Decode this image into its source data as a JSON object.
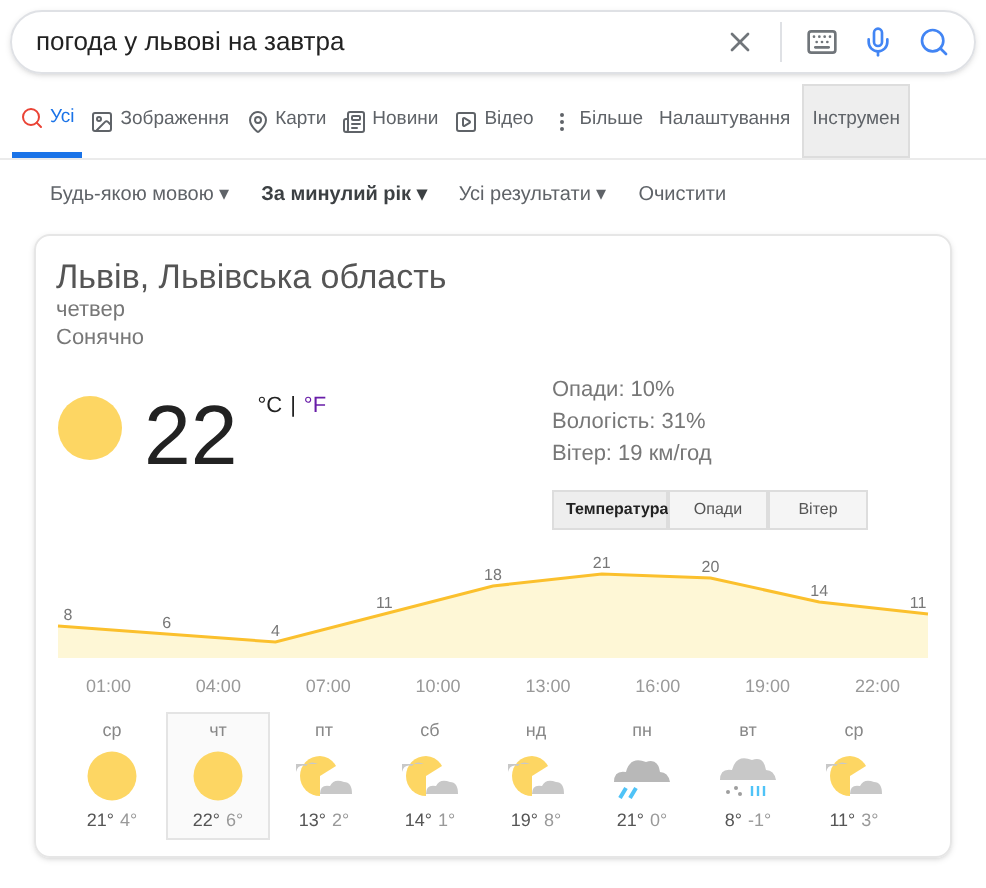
{
  "search": {
    "value": "погода у львові на завтра"
  },
  "tabs": [
    {
      "label": "Усі",
      "kind": "search",
      "selected": true
    },
    {
      "label": "Зображення",
      "kind": "image",
      "selected": false
    },
    {
      "label": "Карти",
      "kind": "pin",
      "selected": false
    },
    {
      "label": "Новини",
      "kind": "news",
      "selected": false
    },
    {
      "label": "Відео",
      "kind": "video",
      "selected": false
    },
    {
      "label": "Більше",
      "kind": "more",
      "selected": false
    },
    {
      "label": "Налаштування",
      "kind": "text",
      "selected": false
    },
    {
      "label": "Інструмен",
      "kind": "text",
      "selected": true
    }
  ],
  "filters": [
    {
      "label": "Будь-якою мовою",
      "caret": "▾",
      "bold": false
    },
    {
      "label": "За минулий рік",
      "caret": "▾",
      "bold": true
    },
    {
      "label": "Усі результати",
      "caret": "▾",
      "bold": false
    },
    {
      "label": "Очистити",
      "bold": false
    }
  ],
  "weather": {
    "location": "Львів, Львівська область",
    "day": "четвер",
    "condition": "Сонячно",
    "temperature": "22",
    "unit_c": "°C",
    "unit_sep": "|",
    "unit_f": "°F",
    "details": [
      "Опади: 10%",
      "Вологість: 31%",
      "Вітер: 19 км/год"
    ],
    "modes": [
      {
        "label": "Температура",
        "selected": true
      },
      {
        "label": "Опади",
        "selected": false
      },
      {
        "label": "Вітер",
        "selected": false
      }
    ],
    "chart_data": {
      "type": "area",
      "categories": [
        null,
        null,
        null,
        null,
        null,
        null,
        null,
        null,
        null
      ],
      "data_labels": true,
      "series": [
        {
          "color": "#fbc02d",
          "values": [
            8,
            6,
            4,
            11,
            18,
            21,
            20,
            14,
            11
          ]
        }
      ]
    },
    "hours": [
      "01:00",
      "04:00",
      "07:00",
      "10:00",
      "13:00",
      "16:00",
      "19:00",
      "22:00"
    ],
    "days": [
      {
        "name": "ср",
        "kind": "sun",
        "high": "21°",
        "low": "4°",
        "selected": false
      },
      {
        "name": "чт",
        "kind": "sun",
        "high": "22°",
        "low": "6°",
        "selected": true
      },
      {
        "name": "пт",
        "kind": "partly",
        "high": "13°",
        "low": "2°",
        "selected": false
      },
      {
        "name": "сб",
        "kind": "partly",
        "high": "14°",
        "low": "1°",
        "selected": false
      },
      {
        "name": "нд",
        "kind": "partly",
        "high": "19°",
        "low": "8°",
        "selected": false
      },
      {
        "name": "пн",
        "kind": "rain",
        "high": "21°",
        "low": "0°",
        "selected": false
      },
      {
        "name": "вт",
        "kind": "sleet",
        "high": "8°",
        "low": "-1°",
        "selected": false
      },
      {
        "name": "ср",
        "kind": "partly",
        "high": "11°",
        "low": "3°",
        "selected": false
      }
    ]
  }
}
